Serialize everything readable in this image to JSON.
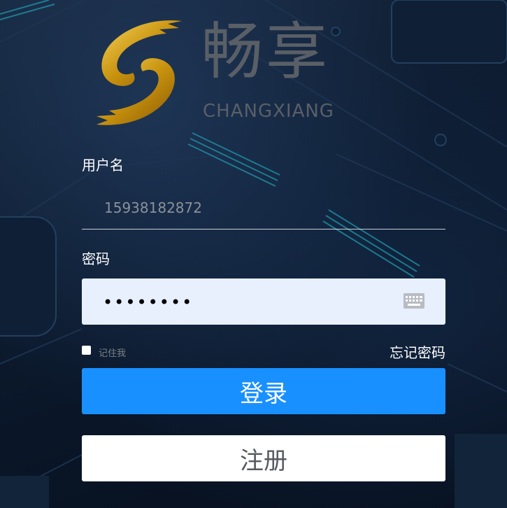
{
  "brand": {
    "name_cn": "畅享",
    "name_en": "CHANGXIANG"
  },
  "form": {
    "username_label": "用户名",
    "username_value": "15938182872",
    "password_label": "密码",
    "password_value": "••••••••",
    "remember_label": "记住我",
    "forgot_label": "忘记密码",
    "login_label": "登录",
    "register_label": "注册"
  },
  "colors": {
    "primary": "#1890ff",
    "logo_gold": "#d4a017",
    "password_bg": "#e8f0fe"
  },
  "icons": {
    "password_toggle": "keyboard-icon"
  }
}
